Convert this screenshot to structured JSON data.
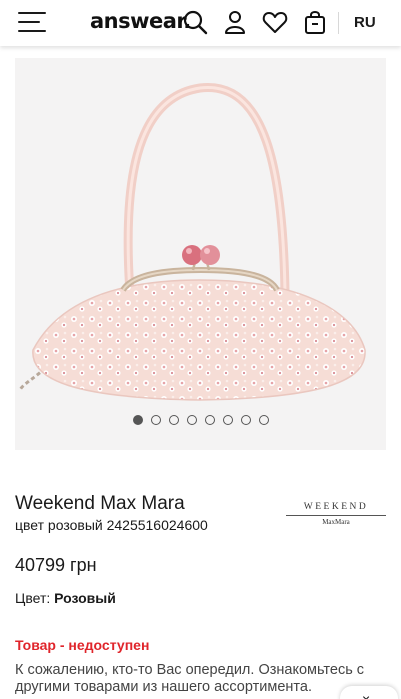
{
  "header": {
    "logo": "answear.",
    "language": "RU",
    "icons": [
      "menu-icon",
      "search-icon",
      "user-icon",
      "heart-icon",
      "bag-icon"
    ]
  },
  "gallery": {
    "image_count": 8,
    "active_index": 0
  },
  "product": {
    "brand": "Weekend Max Mara",
    "color_code": "цвет розовый 2425516024600",
    "brand_logo_top": "WEEKEND",
    "brand_logo_bottom": "MaxMara",
    "price": "40799 грн",
    "color_label": "Цвет:",
    "color_value": "Розовый",
    "unavailable": "Товар - недоступен",
    "sorry_text": "К сожалению, кто-то Вас опередил. Ознакомьтесь с другими товарами из нашего ассортимента."
  },
  "chat": {
    "label": "×"
  },
  "colors": {
    "accent_red": "#e0252b",
    "gallery_bg": "#f4f3f3",
    "bag_pink": "#f5d9d3",
    "clasp_pink": "#d9707e"
  }
}
